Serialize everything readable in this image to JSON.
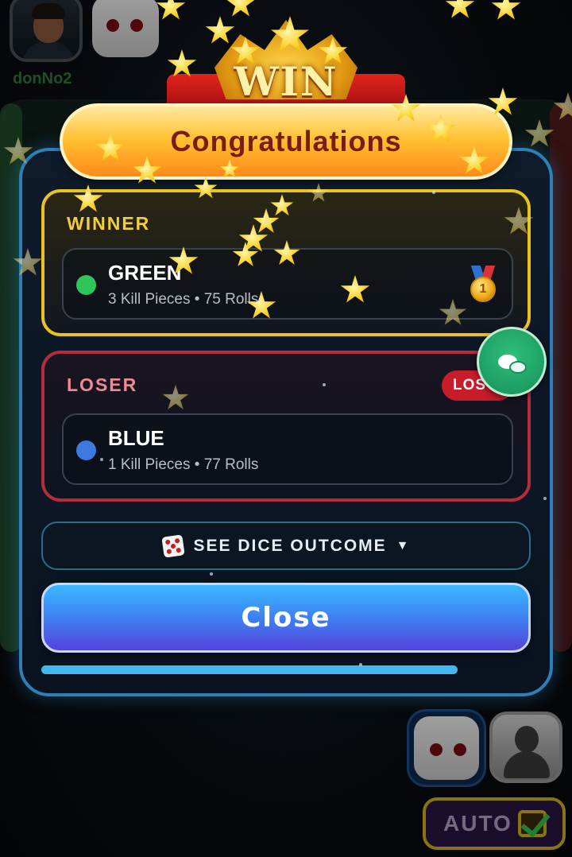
{
  "background": {
    "top_player_name": "donNo2",
    "auto_button_label": "AUTO",
    "auto_checked": true
  },
  "banner": {
    "win_label": "WIN",
    "title": "Congratulations"
  },
  "winner": {
    "section_label": "WINNER",
    "player": "GREEN",
    "stats": "3 Kill Pieces • 75 Rolls",
    "color": "#2ec55a",
    "medal": "gold-medal-icon"
  },
  "loser": {
    "section_label": "LOSER",
    "badge": "LOST",
    "player": "BLUE",
    "stats": "1 Kill Pieces • 77 Rolls",
    "color": "#3d7ae0"
  },
  "dice_outcome": {
    "label": "SEE DICE OUTCOME",
    "icon": "dice-icon",
    "caret": "▼"
  },
  "close_button": {
    "label": "Close"
  },
  "progress": {
    "fraction": 0.85
  },
  "chat_button": {
    "icon": "chat-icon"
  },
  "colors": {
    "winner_border": "#e8c321",
    "loser_border": "#b32d3a",
    "modal_border": "#2d7fb8",
    "close_button": "#3f7bf0"
  }
}
